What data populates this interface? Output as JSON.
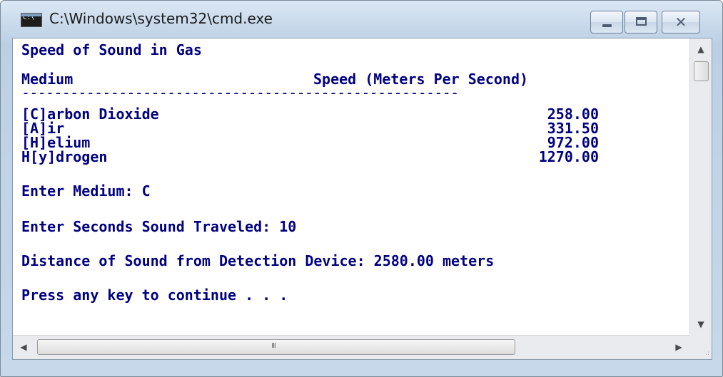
{
  "window": {
    "title": "C:\\Windows\\system32\\cmd.exe",
    "app_icon_text": "C:\\",
    "minimize_symbol": "—",
    "maximize_symbol": "☐",
    "close_symbol": "✕"
  },
  "console": {
    "heading": "Speed of Sound in Gas",
    "table_header_medium": "Medium",
    "table_header_speed": "Speed (Meters Per Second)",
    "separator": "------------------------------------------------------",
    "rows": [
      {
        "medium": "[C]arbon Dioxide",
        "speed": "258.00"
      },
      {
        "medium": "[A]ir",
        "speed": "331.50"
      },
      {
        "medium": "[H]elium",
        "speed": "972.00"
      },
      {
        "medium": "H[y]drogen",
        "speed": "1270.00"
      }
    ],
    "prompt_medium": "Enter Medium: C",
    "prompt_seconds": "Enter Seconds Sound Traveled: 10",
    "result": "Distance of Sound from Detection Device: 2580.00 meters",
    "continue": "Press any key to continue . . ."
  },
  "scrollbars": {
    "up_arrow": "▲",
    "down_arrow": "▼",
    "left_arrow": "◀",
    "right_arrow": "▶",
    "h_grip": "III",
    "size_grip": ".:"
  },
  "colors": {
    "console_text": "#000080",
    "console_background": "#ffffff",
    "frame": "#c5d7ea"
  }
}
